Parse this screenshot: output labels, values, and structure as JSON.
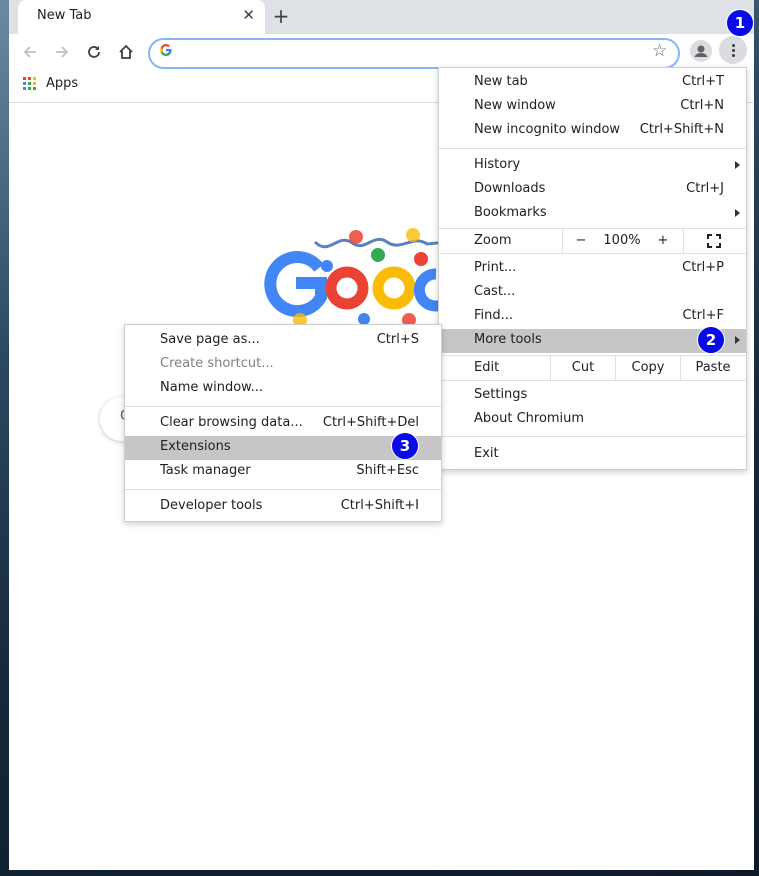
{
  "tab": {
    "title": "New Tab",
    "close_glyph": "✕"
  },
  "toolbar": {
    "new_tab_glyph": "+",
    "star_glyph": "☆",
    "omnibox_value": ""
  },
  "bookmarks": {
    "apps_label": "Apps"
  },
  "badges": {
    "one": "1",
    "two": "2",
    "three": "3"
  },
  "main_menu": {
    "new_tab": {
      "label": "New tab",
      "shortcut": "Ctrl+T"
    },
    "new_window": {
      "label": "New window",
      "shortcut": "Ctrl+N"
    },
    "new_incognito": {
      "label": "New incognito window",
      "shortcut": "Ctrl+Shift+N"
    },
    "history": {
      "label": "History"
    },
    "downloads": {
      "label": "Downloads",
      "shortcut": "Ctrl+J"
    },
    "bookmarks": {
      "label": "Bookmarks"
    },
    "zoom": {
      "label": "Zoom",
      "minus": "−",
      "value": "100%",
      "plus": "+"
    },
    "print": {
      "label": "Print...",
      "shortcut": "Ctrl+P"
    },
    "cast": {
      "label": "Cast..."
    },
    "find": {
      "label": "Find...",
      "shortcut": "Ctrl+F"
    },
    "more_tools": {
      "label": "More tools"
    },
    "edit": {
      "label": "Edit",
      "cut": "Cut",
      "copy": "Copy",
      "paste": "Paste"
    },
    "settings": {
      "label": "Settings"
    },
    "about": {
      "label": "About Chromium"
    },
    "exit": {
      "label": "Exit"
    }
  },
  "more_tools_menu": {
    "save_page": {
      "label": "Save page as...",
      "shortcut": "Ctrl+S"
    },
    "create_shortcut": {
      "label": "Create shortcut..."
    },
    "name_window": {
      "label": "Name window..."
    },
    "clear_browsing": {
      "label": "Clear browsing data...",
      "shortcut": "Ctrl+Shift+Del"
    },
    "extensions": {
      "label": "Extensions"
    },
    "task_manager": {
      "label": "Task manager",
      "shortcut": "Shift+Esc"
    },
    "developer_tools": {
      "label": "Developer tools",
      "shortcut": "Ctrl+Shift+I"
    }
  },
  "highlighted": [
    "More tools",
    "Extensions"
  ],
  "colors": {
    "badge": "#0a0ae6",
    "highlight": "#c6c6c6",
    "omnibox_focus": "#8ab4f8"
  }
}
